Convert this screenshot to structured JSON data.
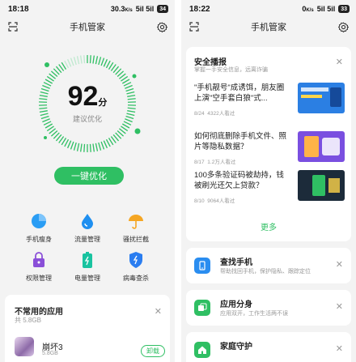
{
  "left": {
    "status": {
      "time": "18:18",
      "speed": "30.3",
      "speed_unit": "K/s",
      "signal": "5il 5il",
      "battery": "34"
    },
    "title": "手机管家",
    "score": {
      "value": "92",
      "unit": "分",
      "label": "建议优化"
    },
    "optimize_label": "一键优化",
    "tools": [
      {
        "label": "手机瘦身",
        "icon": "pie-chart-icon",
        "color": "#2a9df4"
      },
      {
        "label": "流量管理",
        "icon": "water-drop-icon",
        "color": "#1e8ff0"
      },
      {
        "label": "骚扰拦截",
        "icon": "umbrella-icon",
        "color": "#f5a623"
      },
      {
        "label": "权限管理",
        "icon": "lock-icon",
        "color": "#8a4fd8"
      },
      {
        "label": "电量管理",
        "icon": "battery-icon",
        "color": "#19c3a0"
      },
      {
        "label": "病毒查杀",
        "icon": "shield-icon",
        "color": "#2a7df0"
      }
    ],
    "rare_apps": {
      "title": "不常用的应用",
      "subtitle": "共 5.8GB",
      "apps": [
        {
          "name": "崩坏3",
          "size": "5.8GB",
          "action": "卸载"
        }
      ]
    }
  },
  "right": {
    "status": {
      "time": "18:22",
      "speed": "0",
      "speed_unit": "K/s",
      "signal": "5il 5il",
      "battery": "33"
    },
    "title": "手机管家",
    "news": {
      "title": "安全播报",
      "subtitle": "掌握一手安全信息，远离诈骗",
      "items": [
        {
          "title": "\"手机靓号\"成诱饵，朋友圈上演\"空手套白狼\"式...",
          "date": "8/24",
          "views": "4322人看过",
          "thumb_color": "#2b7fe3"
        },
        {
          "title": "如何彻底删除手机文件、照片等隐私数据？",
          "date": "8/17",
          "views": "1.2万人看过",
          "thumb_color": "#7a4fe0"
        },
        {
          "title": "100多条验证码被劫持，钱被刷光还欠上贷款？",
          "date": "8/10",
          "views": "9064人看过",
          "thumb_color": "#1c2b3a"
        }
      ],
      "more_label": "更多"
    },
    "features": [
      {
        "title": "查找手机",
        "subtitle": "帮助找回手机，保护隐私、跟踪定位",
        "icon": "find-phone-icon",
        "color": "#2a8df0"
      },
      {
        "title": "应用分身",
        "subtitle": "应用双开，工作生活两不误",
        "icon": "app-clone-icon",
        "color": "#2fbf63"
      },
      {
        "title": "家庭守护",
        "subtitle": "",
        "icon": "family-guard-icon",
        "color": "#2fbf63"
      }
    ]
  }
}
